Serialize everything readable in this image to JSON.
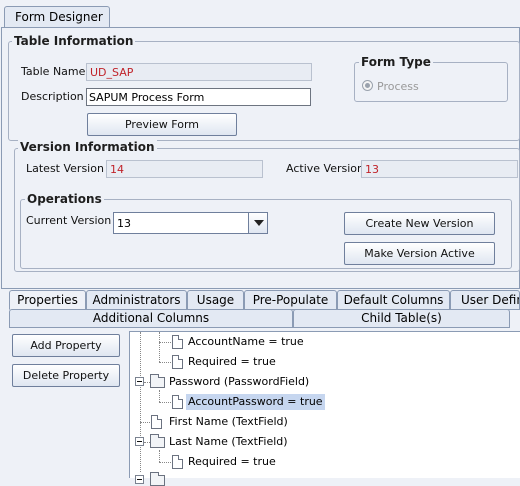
{
  "window": {
    "tab_title": "Form Designer"
  },
  "table_info": {
    "title": "Table Information",
    "table_name_label": "Table Name",
    "table_name_value": "UD_SAP",
    "description_label": "Description",
    "description_value": "SAPUM Process Form",
    "preview_button": "Preview Form"
  },
  "form_type": {
    "title": "Form Type",
    "option_label": "Process",
    "selected": true
  },
  "version_info": {
    "title": "Version Information",
    "latest_label": "Latest Version",
    "latest_value": "14",
    "active_label": "Active Version",
    "active_value": "13"
  },
  "operations": {
    "title": "Operations",
    "current_version_label": "Current Version",
    "current_version_value": "13",
    "create_button": "Create New Version",
    "activate_button": "Make Version Active"
  },
  "property_tabs": [
    "Properties",
    "Administrators",
    "Usage",
    "Pre-Populate",
    "Default Columns",
    "User Defin"
  ],
  "secondary_tabs": [
    "Additional Columns",
    "Child Table(s)"
  ],
  "side_buttons": {
    "add": "Add Property",
    "delete": "Delete Property"
  },
  "tree": [
    {
      "text": "AccountName = true",
      "kind": "leaf"
    },
    {
      "text": "Required = true",
      "kind": "leaf"
    },
    {
      "text": "Password (PasswordField)",
      "kind": "folder"
    },
    {
      "text": "AccountPassword = true",
      "kind": "leaf",
      "selected": true
    },
    {
      "text": "First Name (TextField)",
      "kind": "leaf"
    },
    {
      "text": "Last Name (TextField)",
      "kind": "folder"
    },
    {
      "text": "Required = true",
      "kind": "leaf"
    }
  ],
  "colors": {
    "readonly_text": "#c0232a",
    "selection": "#c6d6ef",
    "panel_bg": "#eef1f7"
  }
}
